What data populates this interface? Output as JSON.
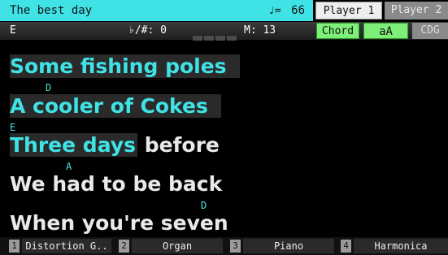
{
  "header": {
    "song_title": "The best day",
    "tempo_symbol": "♩=",
    "tempo_value": "66",
    "players": [
      {
        "label": "Player 1",
        "active": true
      },
      {
        "label": "Player 2",
        "active": false
      }
    ]
  },
  "info": {
    "key": "E",
    "transpose": "♭/#: 0",
    "measure": "M: 13",
    "chord_button": "Chord",
    "font_button": "aA",
    "cdg_button": "CDG"
  },
  "lyrics": [
    {
      "highlighted": "Some fishing poles",
      "rest": "",
      "chord": ""
    },
    {
      "highlighted": "A cooler of Cokes",
      "rest": "",
      "chord": "D"
    },
    {
      "highlighted": "Three days",
      "rest": "before",
      "chord": "E"
    },
    {
      "highlighted": "",
      "rest": "We had to be back",
      "chord": "A"
    },
    {
      "highlighted": "",
      "rest": "When you're seven",
      "chord": "D"
    }
  ],
  "tracks": [
    {
      "num": "1",
      "name": "Distortion G.."
    },
    {
      "num": "2",
      "name": "Organ"
    },
    {
      "num": "3",
      "name": "Piano"
    },
    {
      "num": "4",
      "name": "Harmonica"
    }
  ],
  "colors": {
    "accent_cyan": "#3fe3e6",
    "button_green": "#7ef07a",
    "background": "#000000"
  }
}
